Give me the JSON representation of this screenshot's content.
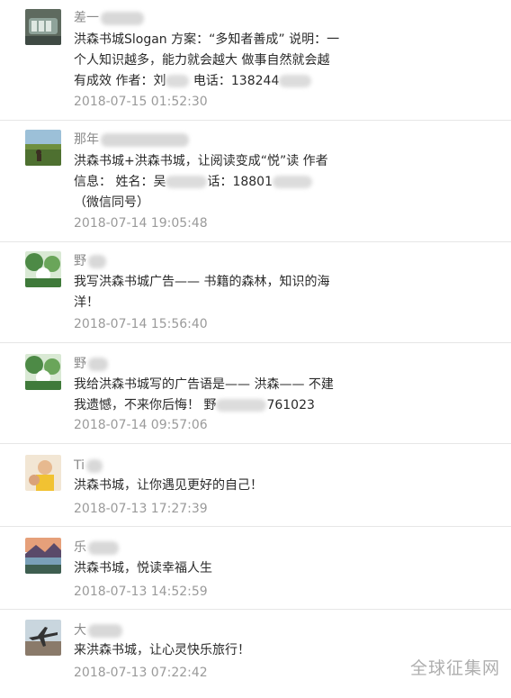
{
  "comments": [
    {
      "name": "差一",
      "text_a": "洪森书城Slogan 方案：“多知者善成” 说明：一个人知识越多，能力就会越大 做事自然就会越有成效 作者：刘",
      "text_b": " 电话：138244",
      "time": "2018-07-15 01:52:30",
      "avatar_icon": "lock-photo-icon"
    },
    {
      "name": "那年",
      "text_a": "洪森书城+洪森书城，让阅读变成“悦”读 作者信息： 姓名：吴",
      "text_b": "话：18801",
      "text_c": "（微信同号）",
      "time": "2018-07-14 19:05:48",
      "avatar_icon": "grassland-photo-icon"
    },
    {
      "name": "野",
      "text_a": "我写洪森书城广告—— 书籍的森林，知识的海洋！",
      "time": "2018-07-14 15:56:40",
      "avatar_icon": "forest-photo-icon"
    },
    {
      "name": "野",
      "text_a": "我给洪森书城写的广告语是—— 洪森—— 不建我遗憾，不来你后悔！ 野",
      "text_b": "761023",
      "time": "2018-07-14 09:57:06",
      "avatar_icon": "forest-photo-icon"
    },
    {
      "name": "Ti",
      "text_a": "洪森书城，让你遇见更好的自己！",
      "time": "2018-07-13 17:27:39",
      "avatar_icon": "child-photo-icon"
    },
    {
      "name": "乐",
      "text_a": "洪森书城，悦读幸福人生",
      "time": "2018-07-13 14:52:59",
      "avatar_icon": "lake-photo-icon"
    },
    {
      "name": "大",
      "text_a": "来洪森书城，让心灵快乐旅行！",
      "time": "2018-07-13 07:22:42",
      "avatar_icon": "airplane-photo-icon"
    }
  ],
  "watermark": "全球征集网"
}
